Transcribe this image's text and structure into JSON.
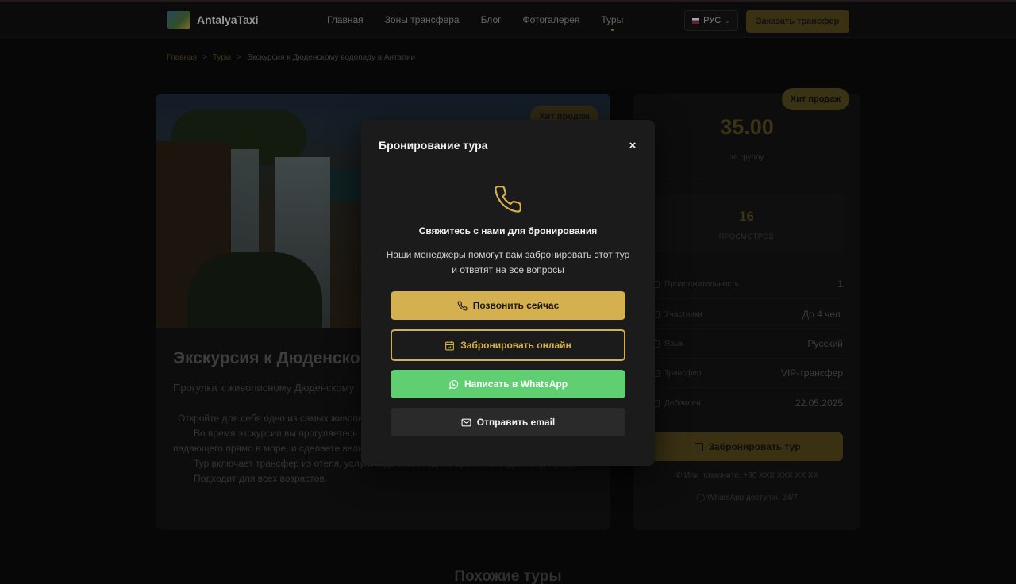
{
  "header": {
    "brand": "AntalyaTaxi",
    "nav": [
      "Главная",
      "Зоны трансфера",
      "Блог",
      "Фотогалерея",
      "Туры"
    ],
    "language": "РУС",
    "cta": "Заказать трансфер"
  },
  "breadcrumb": [
    "Главная",
    "Туры",
    "Экскурсия к Дюденскому водопаду в Анталии"
  ],
  "tour": {
    "badge": "Хит продаж",
    "title": "Экскурсия к Дюденско",
    "subtitle": "Прогулка к живописному Дюденскому",
    "description": [
      "Откройте для себя одно из самых живопи",
      "Во время экскурсии вы прогуляетесь",
      "падающего прямо в море, и сделаете вели",
      "Тур включает трансфер из отеля, услуги гида и свободное время на отдых и прогулку.",
      "Подходит для всех возрастов."
    ]
  },
  "sidebar": {
    "badge": "Хит продаж",
    "price": "35.00",
    "price_unit": "за группу",
    "views": "16",
    "views_label": "ПРОСМОТРОВ",
    "specs": [
      {
        "key": "Продолжительность",
        "value": "1"
      },
      {
        "key": "Участники",
        "value": "До 4 чел."
      },
      {
        "key": "Язык",
        "value": "Русский"
      },
      {
        "key": "Трансфер",
        "value": "VIP-трансфер"
      },
      {
        "key": "Добавлен",
        "value": "22.05.2025"
      }
    ],
    "book_button": "Забронировать тур",
    "call_hint": "Или позвоните: +90 XXX XXX XX XX",
    "whatsapp_hint": "WhatsApp доступен 24/7"
  },
  "similar_title": "Похожие туры",
  "modal": {
    "title": "Бронирование тура",
    "close": "×",
    "heading": "Свяжитесь с нами для бронирования",
    "text": "Наши менеджеры помогут вам забронировать этот тур и ответят на все вопросы",
    "buttons": {
      "call": "Позвонить сейчас",
      "online": "Забронировать онлайн",
      "whatsapp": "Написать в WhatsApp",
      "email": "Отправить email"
    }
  },
  "colors": {
    "accent": "#d4b04e",
    "whatsapp": "#5fcf72",
    "background": "#0b0b0b"
  }
}
